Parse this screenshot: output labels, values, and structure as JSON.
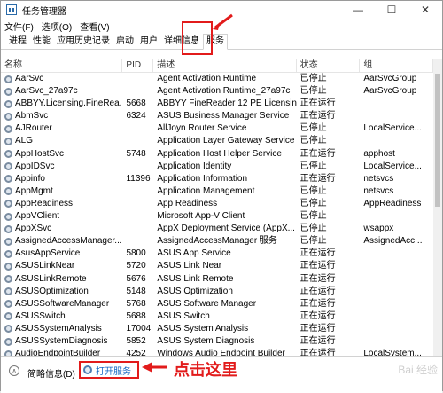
{
  "window": {
    "title": "任务管理器",
    "buttons": [
      "—",
      "☐",
      "✕"
    ]
  },
  "menu": [
    "文件(F)",
    "选项(O)",
    "查看(V)"
  ],
  "tabs": [
    "进程",
    "性能",
    "应用历史记录",
    "启动",
    "用户",
    "详细信息",
    "服务"
  ],
  "active_tab": "服务",
  "columns": [
    "名称",
    "PID",
    "描述",
    "状态",
    "组"
  ],
  "rows": [
    [
      "AarSvc",
      "",
      "Agent Activation Runtime",
      "已停止",
      "AarSvcGroup"
    ],
    [
      "AarSvc_27a97c",
      "",
      "Agent Activation Runtime_27a97c",
      "已停止",
      "AarSvcGroup"
    ],
    [
      "ABBYY.Licensing.FineRea...",
      "5668",
      "ABBYY FineReader 12 PE Licensin...",
      "正在运行",
      ""
    ],
    [
      "AbmSvc",
      "6324",
      "ASUS Business Manager Service",
      "正在运行",
      ""
    ],
    [
      "AJRouter",
      "",
      "AllJoyn Router Service",
      "已停止",
      "LocalService..."
    ],
    [
      "ALG",
      "",
      "Application Layer Gateway Service",
      "已停止",
      ""
    ],
    [
      "AppHostSvc",
      "5748",
      "Application Host Helper Service",
      "正在运行",
      "apphost"
    ],
    [
      "AppIDSvc",
      "",
      "Application Identity",
      "已停止",
      "LocalService..."
    ],
    [
      "Appinfo",
      "11396",
      "Application Information",
      "正在运行",
      "netsvcs"
    ],
    [
      "AppMgmt",
      "",
      "Application Management",
      "已停止",
      "netsvcs"
    ],
    [
      "AppReadiness",
      "",
      "App Readiness",
      "已停止",
      "AppReadiness"
    ],
    [
      "AppVClient",
      "",
      "Microsoft App-V Client",
      "已停止",
      ""
    ],
    [
      "AppXSvc",
      "",
      "AppX Deployment Service (AppX...",
      "已停止",
      "wsappx"
    ],
    [
      "AssignedAccessManager...",
      "",
      "AssignedAccessManager 服务",
      "已停止",
      "AssignedAcc..."
    ],
    [
      "AsusAppService",
      "5800",
      "ASUS App Service",
      "正在运行",
      ""
    ],
    [
      "ASUSLinkNear",
      "5720",
      "ASUS Link Near",
      "正在运行",
      ""
    ],
    [
      "ASUSLinkRemote",
      "5676",
      "ASUS Link Remote",
      "正在运行",
      ""
    ],
    [
      "ASUSOptimization",
      "5148",
      "ASUS Optimization",
      "正在运行",
      ""
    ],
    [
      "ASUSSoftwareManager",
      "5768",
      "ASUS Software Manager",
      "正在运行",
      ""
    ],
    [
      "ASUSSwitch",
      "5688",
      "ASUS Switch",
      "正在运行",
      ""
    ],
    [
      "ASUSSystemAnalysis",
      "17004",
      "ASUS System Analysis",
      "正在运行",
      ""
    ],
    [
      "ASUSSystemDiagnosis",
      "5852",
      "ASUS System Diagnosis",
      "正在运行",
      ""
    ],
    [
      "AudioEndpointBuilder",
      "4252",
      "Windows Audio Endpoint Builder",
      "正在运行",
      "LocalSystem..."
    ]
  ],
  "footer": {
    "fewer_details": "简略信息(D)",
    "open_services": "打开服务"
  },
  "annotation": {
    "text": "点击这里",
    "color": "#e21b1b"
  },
  "watermark": "Bai 经验"
}
